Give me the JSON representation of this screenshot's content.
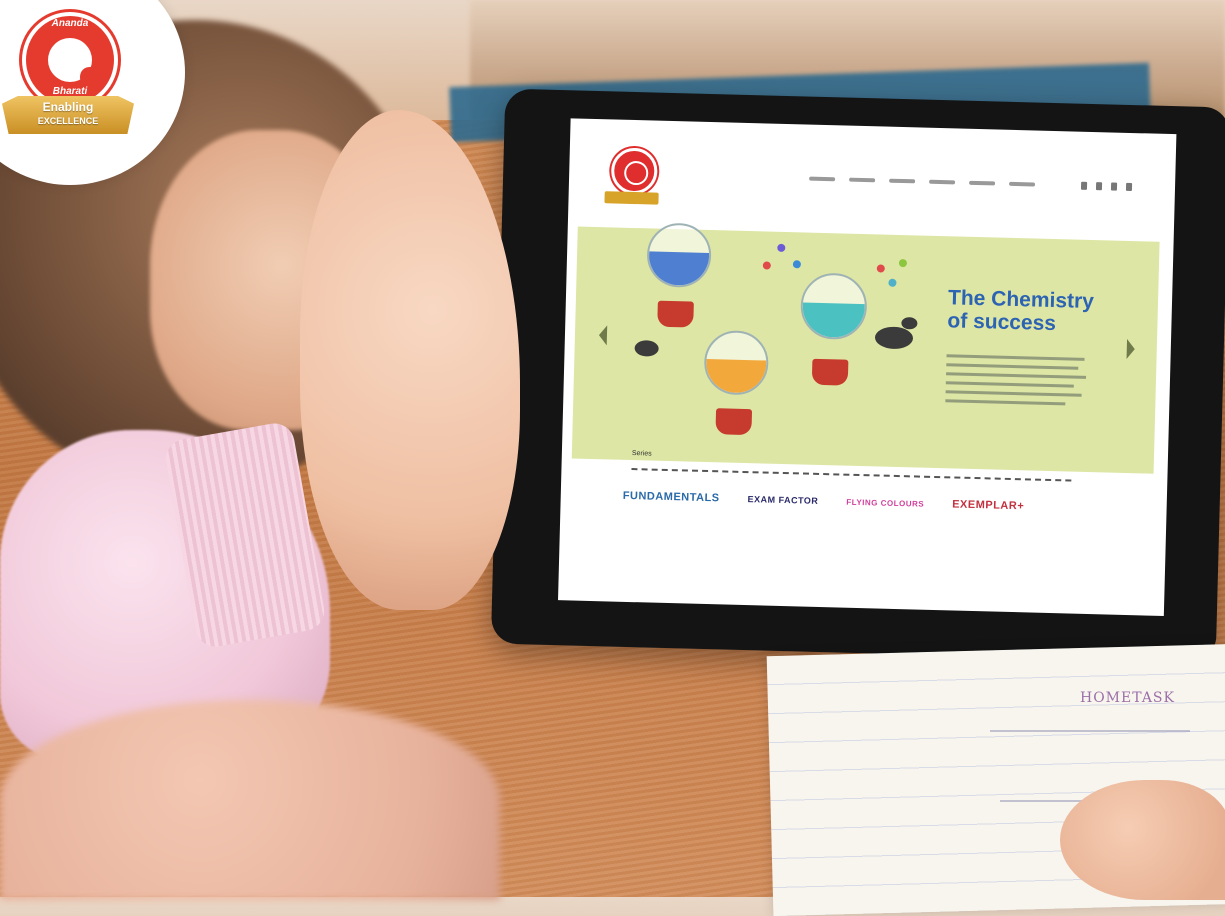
{
  "badge": {
    "brand_top": "Ananda",
    "brand_bottom": "Bharati",
    "ribbon_line1": "Enabling",
    "ribbon_line2": "EXCELLENCE"
  },
  "tablet_site": {
    "headline_line1": "The Chemistry",
    "headline_line2": "of success",
    "series_label": "Series",
    "brands": [
      "FUNDAMENTALS",
      "EXAM FACTOR",
      "FLYING COLOURS",
      "EXEMPLAR+"
    ]
  },
  "notebook": {
    "title": "HOMETASK"
  },
  "colors": {
    "brand_red": "#e53b2f",
    "ribbon_gold": "#d8a329",
    "banner_green": "#dde6a4",
    "headline_blue": "#2c63b3"
  }
}
